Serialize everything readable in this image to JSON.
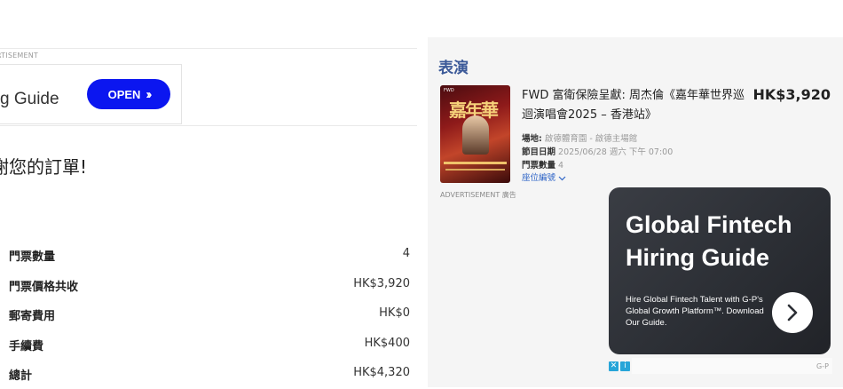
{
  "left_ad": {
    "tag": "RTISEMENT",
    "text": "g Guide",
    "button": "OPEN",
    "button_icon": "chevron-right-double-icon"
  },
  "thanks": "謝您的訂單!",
  "summary": [
    {
      "label": "門票數量",
      "value": "4"
    },
    {
      "label": "門票價格共收",
      "value": "HK$3,920"
    },
    {
      "label": "郵寄費用",
      "value": "HK$0"
    },
    {
      "label": "手續費",
      "value": "HK$400"
    },
    {
      "label": "總計",
      "value": "HK$4,320"
    }
  ],
  "event": {
    "section_title": "表演",
    "title": "FWD 富衛保險呈獻: 周杰倫《嘉年華世界巡迴演唱會2025 – 香港站》",
    "price": "HK$3,920",
    "venue_label": "場地:",
    "venue": "啟德體育園 - 啟德主場館",
    "date_label": "節目日期",
    "date": "2025/06/28 週六 下午 07:00",
    "qty_label": "門票數量",
    "qty": "4",
    "seat_link": "座位編號",
    "poster_text": "嘉年華"
  },
  "right_ad": {
    "label": "ADVERTISEMENT 廣告",
    "headline": "Global Fintech Hiring Guide",
    "body": "Hire Global Fintech Talent with G-P's Global Growth Platform™. Download Our Guide.",
    "sponsor": "G-P"
  },
  "colors": {
    "accent_blue": "#0b16f0",
    "section_title": "#3b5998",
    "link": "#3166c7",
    "ad_dark": "#2c2f35"
  }
}
